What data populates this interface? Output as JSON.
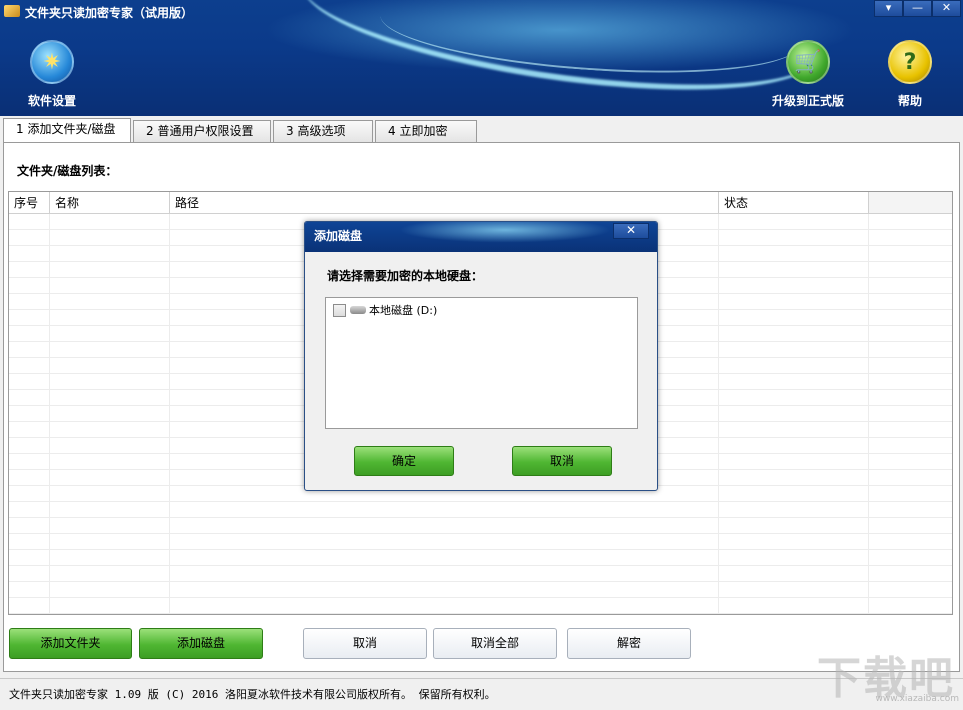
{
  "window": {
    "title": "文件夹只读加密专家（试用版）",
    "controls": [
      "▾",
      "—",
      "✕"
    ]
  },
  "header": {
    "settings_label": "软件设置",
    "upgrade_label": "升级到正式版",
    "help_label": "帮助",
    "help_glyph": "?"
  },
  "tabs": [
    {
      "label": "1 添加文件夹/磁盘"
    },
    {
      "label": "2 普通用户权限设置"
    },
    {
      "label": "3 高级选项"
    },
    {
      "label": "4 立即加密"
    }
  ],
  "main": {
    "list_label": "文件夹/磁盘列表：",
    "columns": [
      "序号",
      "名称",
      "路径",
      "状态"
    ]
  },
  "buttons": {
    "add_folder": "添加文件夹",
    "add_disk": "添加磁盘",
    "cancel": "取消",
    "cancel_all": "取消全部",
    "decrypt": "解密"
  },
  "status_bar": {
    "text": "文件夹只读加密专家 1.09 版  (C)  2016 洛阳夏冰软件技术有限公司版权所有。 保留所有权利。"
  },
  "watermark": {
    "text": "下载吧",
    "url": "www.xiazaiba.com"
  },
  "dialog": {
    "title": "添加磁盘",
    "close": "✕",
    "prompt": "请选择需要加密的本地硬盘：",
    "items": [
      {
        "label": "本地磁盘 (D:)",
        "checked": false
      }
    ],
    "ok": "确定",
    "cancel": "取消"
  },
  "colors": {
    "header_blue": "#0b3a8a",
    "button_green": "#4fb632"
  }
}
